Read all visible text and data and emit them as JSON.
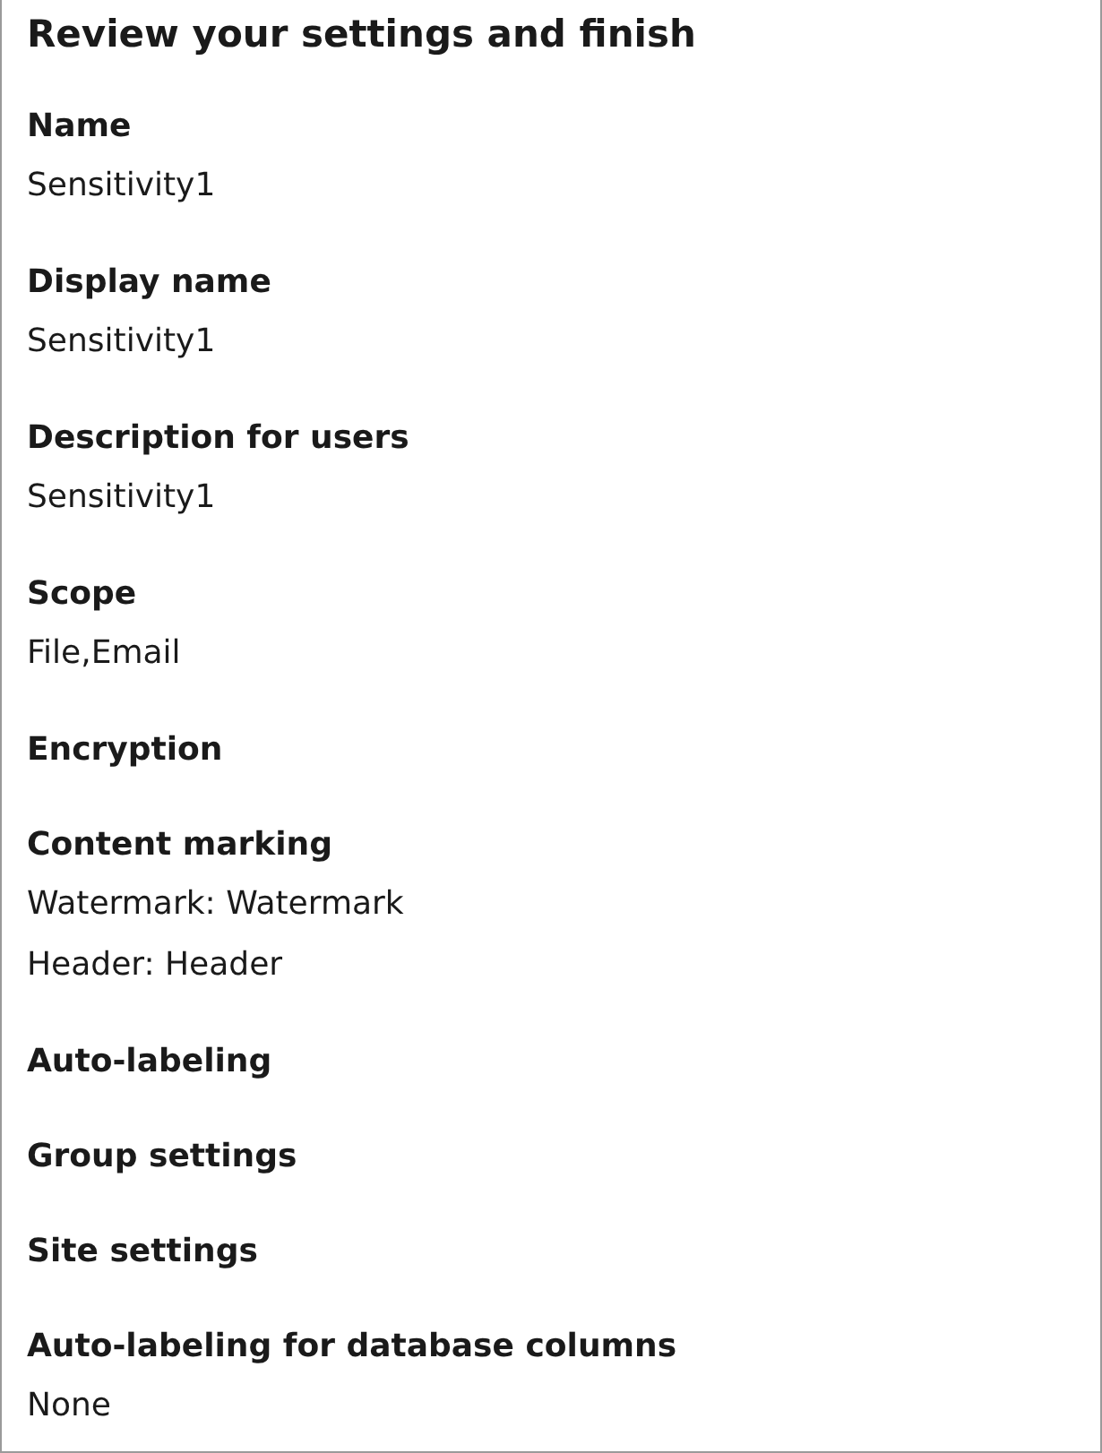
{
  "title": "Review your settings and finish",
  "sections": [
    {
      "heading": "Name",
      "values": [
        "Sensitivity1"
      ]
    },
    {
      "heading": "Display name",
      "values": [
        "Sensitivity1"
      ]
    },
    {
      "heading": "Description for users",
      "values": [
        "Sensitivity1"
      ]
    },
    {
      "heading": "Scope",
      "values": [
        "File,Email"
      ]
    },
    {
      "heading": "Encryption"
    },
    {
      "heading": "Content marking",
      "values": [
        "Watermark: Watermark",
        "Header: Header"
      ]
    },
    {
      "heading": "Auto-labeling"
    },
    {
      "heading": "Group settings"
    },
    {
      "heading": "Site settings"
    },
    {
      "heading": "Auto-labeling for database columns",
      "values": [
        "None"
      ]
    }
  ]
}
